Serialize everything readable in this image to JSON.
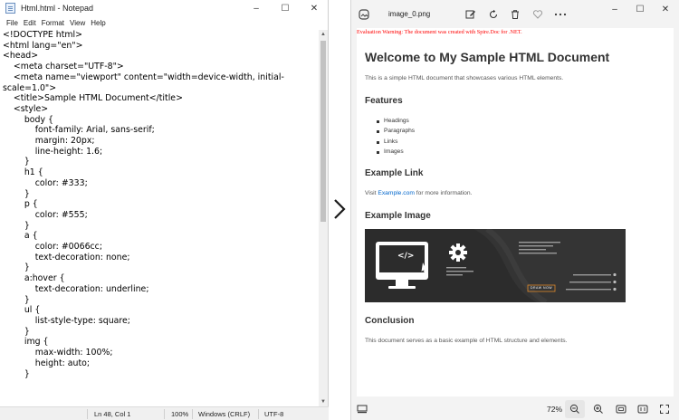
{
  "notepad": {
    "title": "Html.html - Notepad",
    "menu": [
      "File",
      "Edit",
      "Format",
      "View",
      "Help"
    ],
    "lines": [
      "<!DOCTYPE html>",
      "<html lang=\"en\">",
      "<head>",
      "    <meta charset=\"UTF-8\">",
      "    <meta name=\"viewport\" content=\"width=device-width, initial-",
      "scale=1.0\">",
      "    <title>Sample HTML Document</title>",
      "    <style>",
      "        body {",
      "            font-family: Arial, sans-serif;",
      "            margin: 20px;",
      "            line-height: 1.6;",
      "        }",
      "        h1 {",
      "            color: #333;",
      "        }",
      "        p {",
      "            color: #555;",
      "        }",
      "        a {",
      "            color: #0066cc;",
      "            text-decoration: none;",
      "        }",
      "        a:hover {",
      "            text-decoration: underline;",
      "        }",
      "        ul {",
      "            list-style-type: square;",
      "        }",
      "        img {",
      "            max-width: 100%;",
      "            height: auto;",
      "        }"
    ],
    "status": {
      "position": "Ln 48, Col 1",
      "zoom": "100%",
      "line_ending": "Windows (CRLF)",
      "encoding": "UTF-8"
    }
  },
  "photos": {
    "filename": "image_0.png",
    "zoom": "72%",
    "document": {
      "warning": "Evaluation Warning: The document was created with Spire.Doc for .NET.",
      "title": "Welcome to My Sample HTML Document",
      "intro": "This is a simple HTML document that showcases various HTML elements.",
      "features_heading": "Features",
      "features": [
        "Headings",
        "Paragraphs",
        "Links",
        "Images"
      ],
      "link_heading": "Example Link",
      "link_prefix": "Visit ",
      "link_text": "Example.com",
      "link_suffix": " for more information.",
      "image_heading": "Example Image",
      "image_code_tag": "</>",
      "image_button": "DRAW NOW",
      "conclusion_heading": "Conclusion",
      "conclusion_text": "This document serves as a basic example of HTML structure and elements."
    }
  },
  "colors": {
    "link": "#0066cc",
    "heading": "#333333",
    "paragraph": "#555555",
    "warning": "#ff0000"
  }
}
